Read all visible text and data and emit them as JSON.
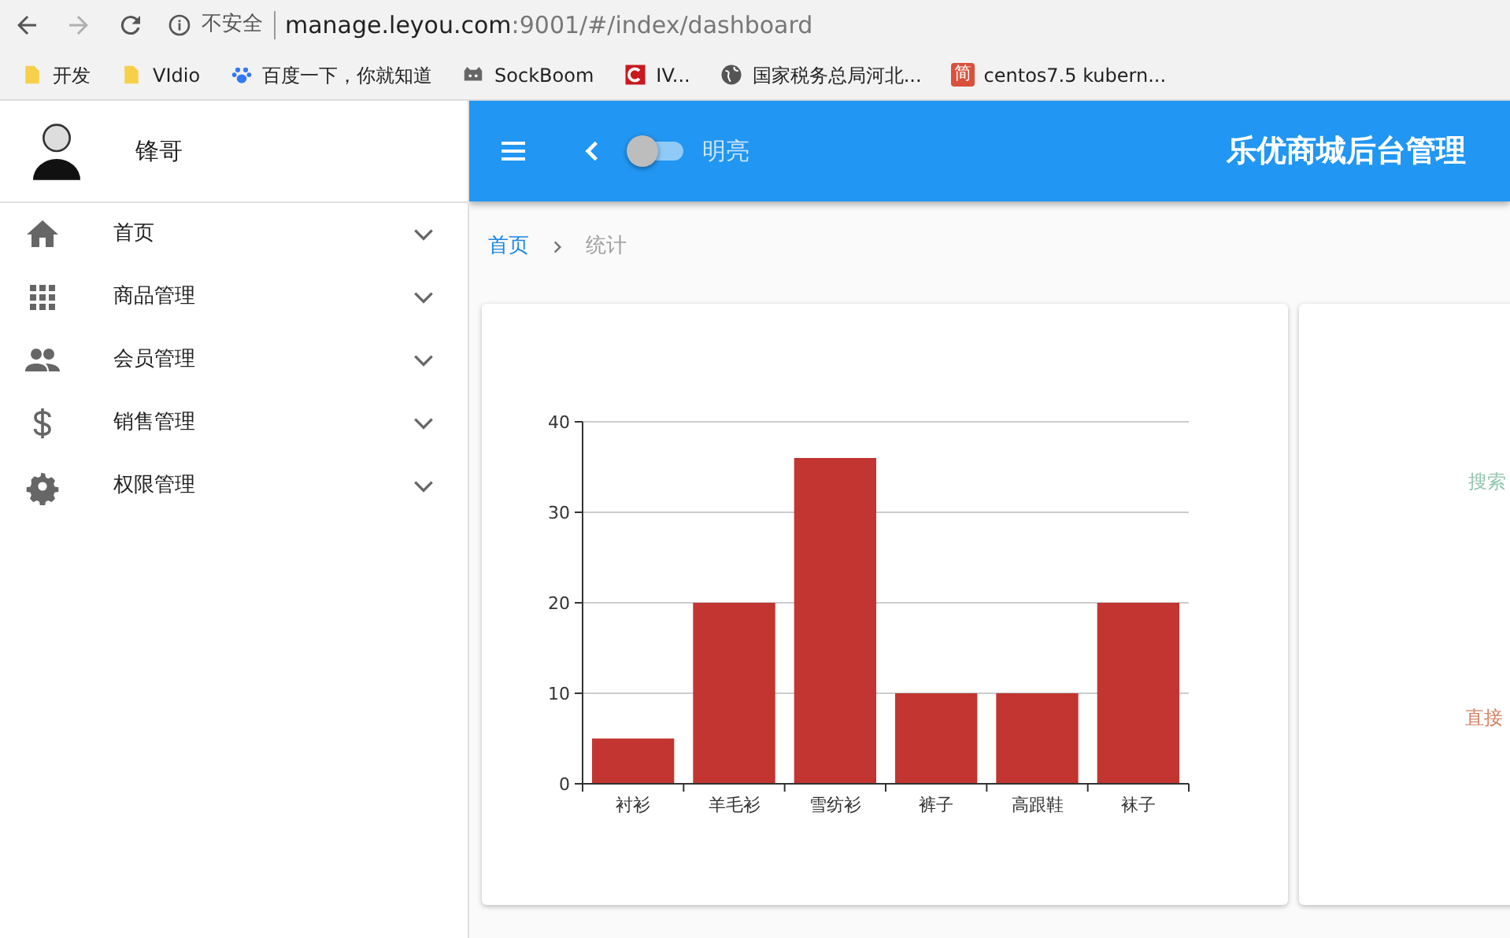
{
  "browser": {
    "nav": [
      {
        "kind": "back",
        "disabled": false
      },
      {
        "kind": "forward",
        "disabled": true
      },
      {
        "kind": "reload",
        "disabled": false
      }
    ],
    "security": "不安全",
    "url_host": "manage.leyou.com",
    "url_path": ":9001/#/index/dashboard",
    "bookmarks": [
      {
        "kind": "folder",
        "label": "开发"
      },
      {
        "kind": "folder",
        "label": "VIdio"
      },
      {
        "kind": "paw",
        "label": "百度一下，你就知道"
      },
      {
        "kind": "robot",
        "label": "SockBoom"
      },
      {
        "kind": "red",
        "label": "IV..."
      },
      {
        "kind": "globe",
        "label": "国家税务总局河北..."
      },
      {
        "kind": "char",
        "glyph": "简",
        "label": "centos7.5 kubern..."
      }
    ]
  },
  "sidebar": {
    "user": "锋哥",
    "items": [
      {
        "kind": "home",
        "label": "首页",
        "expanded": false
      },
      {
        "kind": "grid",
        "label": "商品管理",
        "expanded": false
      },
      {
        "kind": "people",
        "label": "会员管理",
        "expanded": false
      },
      {
        "kind": "dollar",
        "label": "销售管理",
        "expanded": false
      },
      {
        "kind": "gear",
        "label": "权限管理",
        "expanded": false
      }
    ]
  },
  "header": {
    "toggle": {
      "label": "明亮",
      "on": false
    },
    "title": "乐优商城后台管理"
  },
  "breadcrumb": [
    {
      "label": "首页",
      "current": false
    },
    {
      "label": "统计",
      "current": true
    }
  ],
  "chart_data": {
    "type": "bar",
    "categories": [
      "衬衫",
      "羊毛衫",
      "雪纺衫",
      "裤子",
      "高跟鞋",
      "袜子"
    ],
    "series": [
      {
        "color": "#c23531",
        "values": [
          5,
          20,
          36,
          10,
          10,
          20
        ]
      }
    ],
    "grid": true,
    "ylim": [
      0,
      40
    ],
    "yticks": [
      0,
      10,
      20,
      30,
      40
    ]
  },
  "second_card": {
    "legend": [
      {
        "label": "搜索",
        "color": "#91c7ae"
      },
      {
        "label": "直接",
        "color": "#d48265"
      }
    ]
  }
}
